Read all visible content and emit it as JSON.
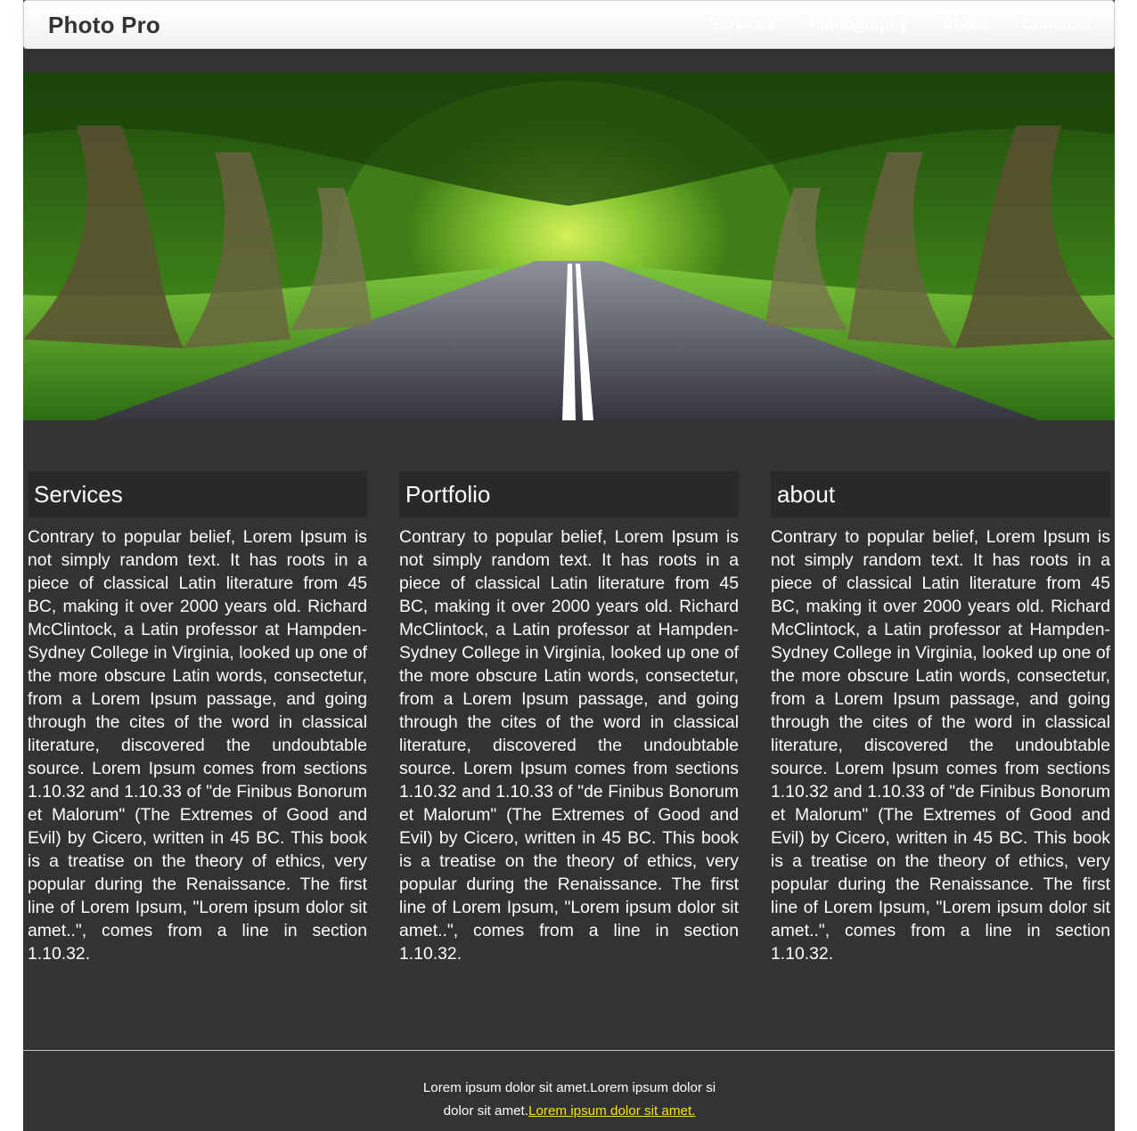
{
  "navbar": {
    "brand": "Photo Pro",
    "links": [
      {
        "label": "Services"
      },
      {
        "label": "Photography"
      },
      {
        "label": "About"
      },
      {
        "label": "Contacts"
      }
    ]
  },
  "hero": {
    "description": "tree-lined road photo"
  },
  "columns": [
    {
      "heading": "Services",
      "text": "Contrary to popular belief, Lorem Ipsum is not simply random text. It has roots in a piece of classical Latin literature from 45 BC, making it over 2000 years old. Richard McClintock, a Latin professor at Hampden-Sydney College in Virginia, looked up one of the more obscure Latin words, consectetur, from a Lorem Ipsum passage, and going through the cites of the word in classical literature, discovered the undoubtable source. Lorem Ipsum comes from sections 1.10.32 and 1.10.33 of \"de Finibus Bonorum et Malorum\" (The Extremes of Good and Evil) by Cicero, written in 45 BC. This book is a treatise on the theory of ethics, very popular during the Renaissance. The first line of Lorem Ipsum, \"Lorem ipsum dolor sit amet..\", comes from a line in section 1.10.32."
    },
    {
      "heading": "Portfolio",
      "text": "Contrary to popular belief, Lorem Ipsum is not simply random text. It has roots in a piece of classical Latin literature from 45 BC, making it over 2000 years old. Richard McClintock, a Latin professor at Hampden-Sydney College in Virginia, looked up one of the more obscure Latin words, consectetur, from a Lorem Ipsum passage, and going through the cites of the word in classical literature, discovered the undoubtable source. Lorem Ipsum comes from sections 1.10.32 and 1.10.33 of \"de Finibus Bonorum et Malorum\" (The Extremes of Good and Evil) by Cicero, written in 45 BC. This book is a treatise on the theory of ethics, very popular during the Renaissance. The first line of Lorem Ipsum, \"Lorem ipsum dolor sit amet..\", comes from a line in section 1.10.32."
    },
    {
      "heading": "about",
      "text": "Contrary to popular belief, Lorem Ipsum is not simply random text. It has roots in a piece of classical Latin literature from 45 BC, making it over 2000 years old. Richard McClintock, a Latin professor at Hampden-Sydney College in Virginia, looked up one of the more obscure Latin words, consectetur, from a Lorem Ipsum passage, and going through the cites of the word in classical literature, discovered the undoubtable source. Lorem Ipsum comes from sections 1.10.32 and 1.10.33 of \"de Finibus Bonorum et Malorum\" (The Extremes of Good and Evil) by Cicero, written in 45 BC. This book is a treatise on the theory of ethics, very popular during the Renaissance. The first line of Lorem Ipsum, \"Lorem ipsum dolor sit amet..\", comes from a line in section 1.10.32."
    }
  ],
  "footer": {
    "text_line1": "Lorem ipsum dolor sit amet.Lorem ipsum dolor si",
    "text_line2": "dolor sit amet.",
    "link_label": "Lorem ipsum dolor sit amet.",
    "link_color": "#f5e21b"
  },
  "colors": {
    "page_background": "#333333",
    "column_heading_background": "#292929",
    "navbar_background": "#f7f7f7"
  }
}
